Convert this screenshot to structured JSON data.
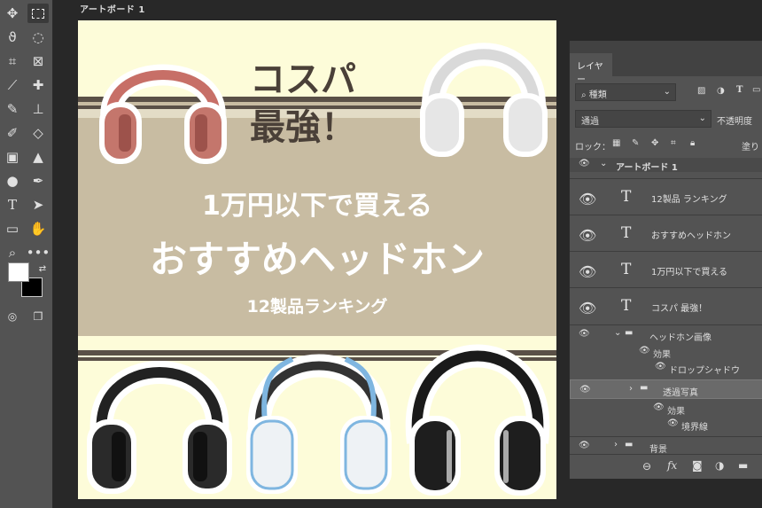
{
  "artboard": {
    "title": "アートボード 1",
    "headline_line1": "コスパ",
    "headline_line2": "最強！",
    "sub1": "1万円以下で買える",
    "sub2": "おすすめヘッドホン",
    "sub3": "12製品ランキング",
    "colors": {
      "bg": "#c8bca2",
      "cream": "#fdfcd9",
      "dark": "#4a4038"
    }
  },
  "toolbar": {
    "tools": [
      "move-icon",
      "marquee-icon",
      "lasso-icon",
      "quick-select-icon",
      "crop-icon",
      "frame-icon",
      "eyedropper-icon",
      "healing-icon",
      "brush-icon",
      "stamp-icon",
      "history-brush-icon",
      "eraser-icon",
      "gradient-icon",
      "blur-icon",
      "dodge-icon",
      "pen-icon",
      "type-icon",
      "path-select-icon",
      "rectangle-icon",
      "hand-icon",
      "zoom-icon",
      "more-icon"
    ]
  },
  "layers_panel": {
    "tab": "レイヤー",
    "filter_kind": "種類",
    "blend_mode": "通過",
    "opacity_label": "不透明度",
    "lock_label": "ロック：",
    "fill_label": "塗り",
    "layers": [
      {
        "name": "アートボード 1",
        "kind": "artboard"
      },
      {
        "name": "12製品 ランキング",
        "kind": "text"
      },
      {
        "name": "おすすめヘッドホン",
        "kind": "text"
      },
      {
        "name": "1万円以下で買える",
        "kind": "text"
      },
      {
        "name": "コスパ 最強！",
        "kind": "text"
      },
      {
        "name": "ヘッドホン画像",
        "kind": "group"
      },
      {
        "name": "効果",
        "kind": "effects"
      },
      {
        "name": "ドロップシャドウ",
        "kind": "effect"
      },
      {
        "name": "透過写真",
        "kind": "group"
      },
      {
        "name": "効果",
        "kind": "effects"
      },
      {
        "name": "境界線",
        "kind": "effect"
      },
      {
        "name": "背景",
        "kind": "group"
      }
    ]
  }
}
